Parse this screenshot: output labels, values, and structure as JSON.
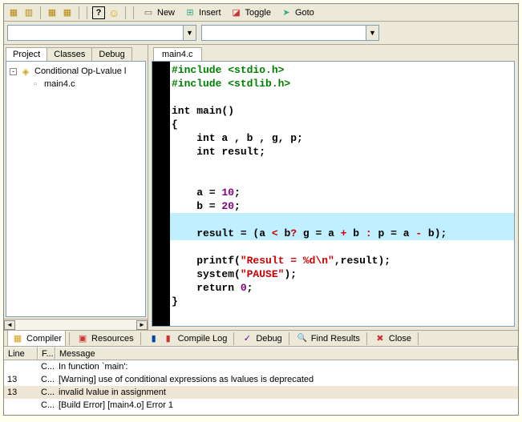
{
  "toolbar": {
    "new_label": "New",
    "insert_label": "Insert",
    "toggle_label": "Toggle",
    "goto_label": "Goto"
  },
  "sidebar": {
    "tabs": [
      "Project",
      "Classes",
      "Debug"
    ],
    "active_tab": 0,
    "root_label": "Conditional Op-Lvalue l",
    "root_expanded": "-",
    "file_label": "main4.c"
  },
  "editor": {
    "tab_label": "main4.c",
    "code": {
      "l1a": "#include ",
      "l1b": "<stdio.h>",
      "l2a": "#include ",
      "l2b": "<stdlib.h>",
      "kw_int": "int",
      "main_sig": " main()",
      "lbrace": "{",
      "decl1": " a , b , g, p;",
      "decl2": " result;",
      "assn_a_eq": "    a = ",
      "assn_a_v": "10",
      "assn_b_eq": "    b = ",
      "assn_b_v": "20",
      "semi": ";",
      "hl_pre": "    result = (a ",
      "hl_lt": "<",
      "hl_mid1": " b",
      "hl_q": "?",
      "hl_mid2": " g = a ",
      "hl_plus": "+",
      "hl_mid3": " b ",
      "hl_colon": ":",
      "hl_mid4": " p = a ",
      "hl_minus": "-",
      "hl_mid5": " b);",
      "printf_call": "    printf(",
      "printf_str": "\"Result = %d\\n\"",
      "printf_tail": ",result);",
      "system_call": "    system(",
      "system_str": "\"PAUSE\"",
      "system_tail": ");",
      "kw_return": "return",
      "return_sp": "    ",
      "return_v": "0",
      "rbrace": "}"
    }
  },
  "bottom_tabs": {
    "compiler": "Compiler",
    "resources": "Resources",
    "compile_log": "Compile Log",
    "debug": "Debug",
    "find_results": "Find Results",
    "close": "Close"
  },
  "output": {
    "headers": {
      "line": "Line",
      "file": "F...",
      "message": "Message"
    },
    "rows": [
      {
        "line": "",
        "file": "C...",
        "msg": "In function `main':",
        "err": false
      },
      {
        "line": "13",
        "file": "C...",
        "msg": "[Warning] use of conditional expressions as lvalues is deprecated",
        "err": false
      },
      {
        "line": "13",
        "file": "C...",
        "msg": "invalid lvalue in assignment",
        "err": true
      },
      {
        "line": "",
        "file": "C...",
        "msg": "[Build Error]  [main4.o] Error 1",
        "err": false
      }
    ]
  }
}
